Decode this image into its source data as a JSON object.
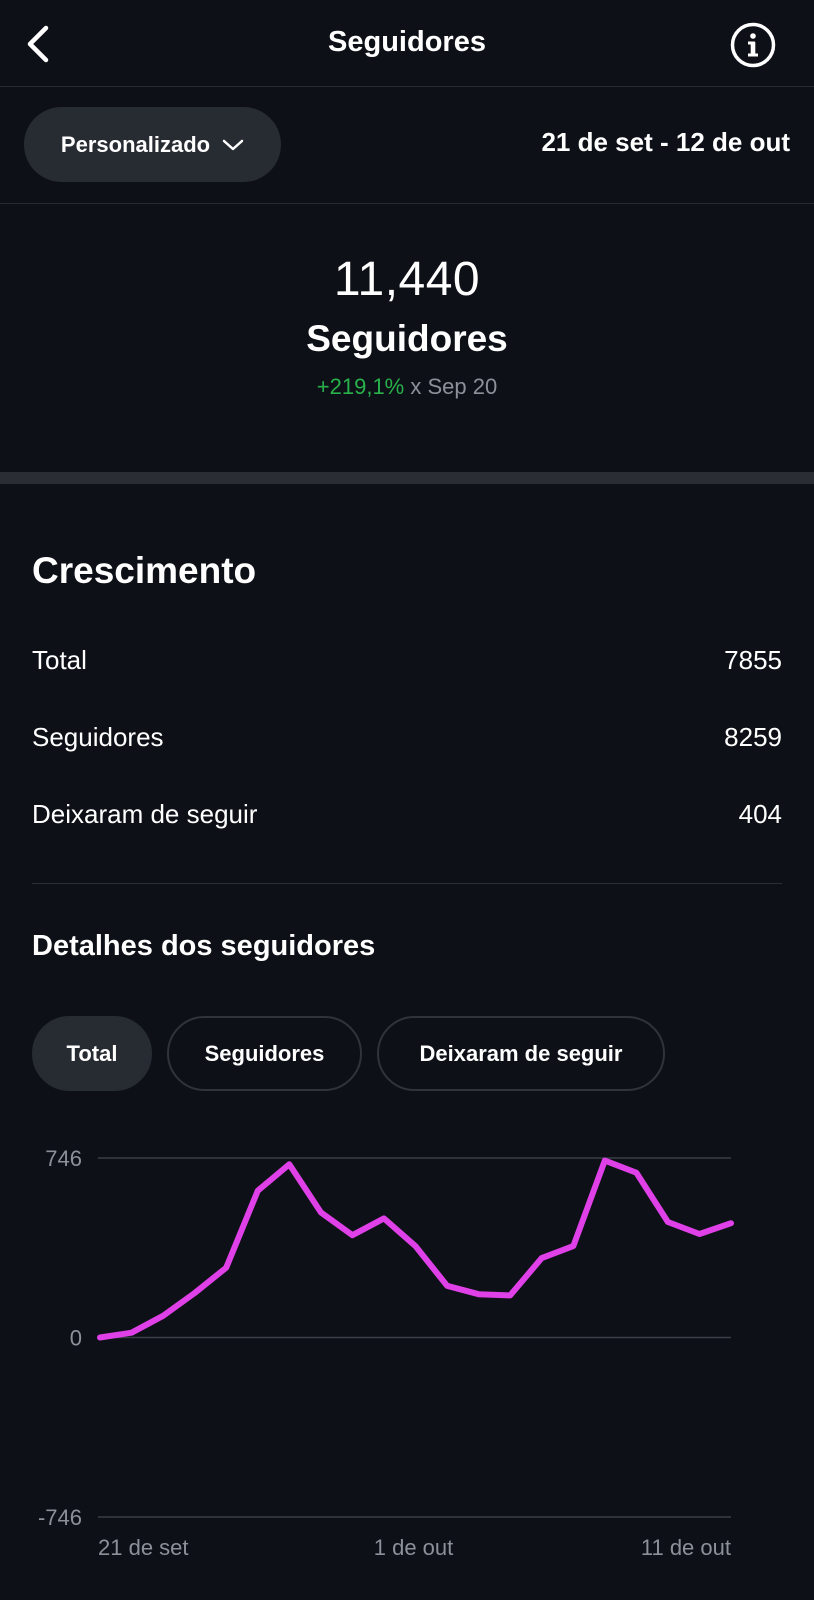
{
  "header": {
    "title": "Seguidores",
    "back_icon": "chevron-left-icon",
    "info_icon": "info-circle-icon"
  },
  "filter": {
    "period_label": "Personalizado",
    "period_icon": "chevron-down-icon",
    "date_range": "21 de set - 12 de out"
  },
  "summary": {
    "count": "11,440",
    "label": "Seguidores",
    "change_pct": "+219,1%",
    "change_ref": "x Sep 20"
  },
  "growth": {
    "title": "Crescimento",
    "rows": [
      {
        "label": "Total",
        "value": "7855"
      },
      {
        "label": "Seguidores",
        "value": "8259"
      },
      {
        "label": "Deixaram de seguir",
        "value": "404"
      }
    ]
  },
  "details": {
    "title": "Detalhes dos seguidores",
    "tabs": [
      {
        "label": "Total",
        "active": true
      },
      {
        "label": "Seguidores",
        "active": false
      },
      {
        "label": "Deixaram de seguir",
        "active": false
      }
    ]
  },
  "colors": {
    "background": "#0d1117",
    "accent_line": "#e040e8",
    "positive": "#28b14a",
    "muted": "#8b9099"
  },
  "chart_data": {
    "type": "line",
    "y_ticks": [
      "746",
      "0",
      "-746"
    ],
    "ylim": [
      -746,
      746
    ],
    "x_tick_labels": [
      "21 de set",
      "1 de out",
      "11 de out"
    ],
    "series": [
      {
        "values": [
          0,
          20,
          90,
          185,
          290,
          610,
          720,
          520,
          425,
          495,
          380,
          215,
          180,
          175,
          330,
          380,
          735,
          685,
          480,
          430,
          475
        ]
      }
    ],
    "grid": true
  }
}
